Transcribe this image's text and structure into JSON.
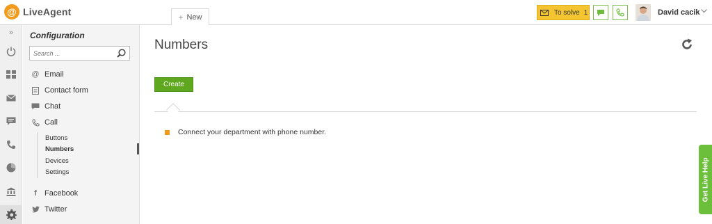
{
  "app": {
    "logo_letter": "@",
    "title": "LiveAgent"
  },
  "tabs": {
    "new_label": "New",
    "new_icon": "plus-icon"
  },
  "header": {
    "to_solve_label": "To solve",
    "to_solve_count": "1",
    "user_name": "David cacik",
    "accent_yellow": "#f5c531",
    "accent_green": "#7cc04a"
  },
  "rail": {
    "items": [
      {
        "icon": "expand-icon",
        "symbol": "»"
      },
      {
        "icon": "power-icon"
      },
      {
        "icon": "dashboard-icon"
      },
      {
        "icon": "tickets-icon"
      },
      {
        "icon": "chat-icon"
      },
      {
        "icon": "calls-icon"
      },
      {
        "icon": "reports-icon"
      },
      {
        "icon": "knowledgebase-icon"
      },
      {
        "icon": "settings-icon"
      }
    ]
  },
  "config": {
    "title": "Configuration",
    "search_placeholder": "Search ...",
    "items": [
      {
        "label": "Email",
        "icon": "at-icon"
      },
      {
        "label": "Contact form",
        "icon": "form-icon"
      },
      {
        "label": "Chat",
        "icon": "chat-bubble-icon"
      },
      {
        "label": "Call",
        "icon": "phone-icon"
      }
    ],
    "call_sub": [
      {
        "label": "Buttons"
      },
      {
        "label": "Numbers",
        "active": true
      },
      {
        "label": "Devices"
      },
      {
        "label": "Settings"
      }
    ],
    "social": [
      {
        "label": "Facebook",
        "icon": "facebook-icon"
      },
      {
        "label": "Twitter",
        "icon": "twitter-icon"
      }
    ]
  },
  "main": {
    "title": "Numbers",
    "create_label": "Create",
    "info_text": "Connect your department with phone number.",
    "brand_green": "#5ea71e",
    "bullet_color": "#f39a1b"
  },
  "live_help": {
    "label": "Get Live Help"
  }
}
